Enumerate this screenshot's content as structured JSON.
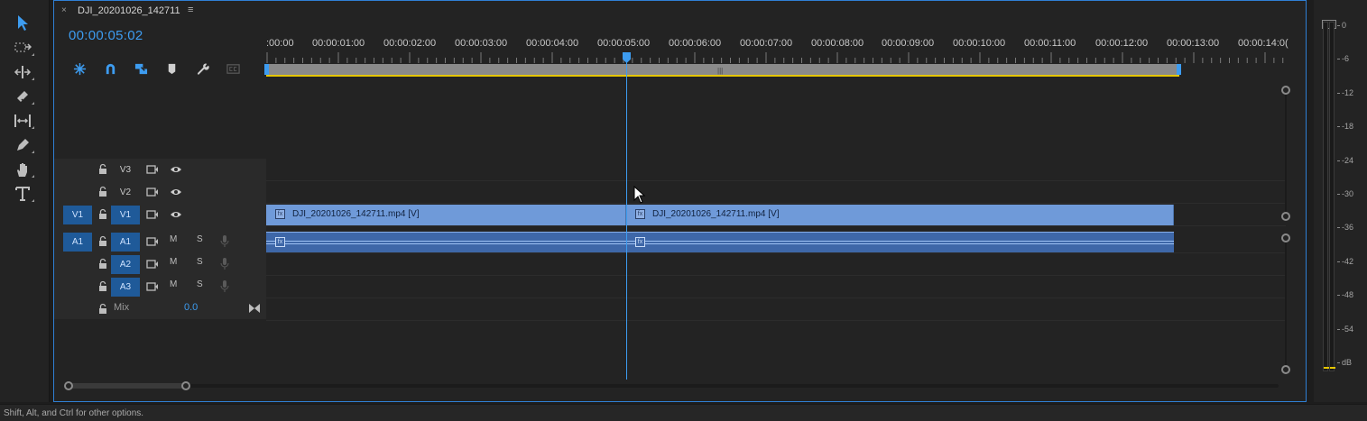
{
  "sequence": {
    "tab_title": "DJI_20201026_142711",
    "close_glyph": "×",
    "menu_glyph": "≡",
    "timecode": "00:00:05:02"
  },
  "toolbar_icons": [
    "ripple-edit-insert-icon",
    "snap-magnet-icon",
    "linked-selection-icon",
    "add-marker-icon",
    "timeline-settings-wrench-icon",
    "captions-icon"
  ],
  "tools": [
    "selection-tool-icon",
    "track-select-tool-icon",
    "ripple-edit-tool-icon",
    "razor-tool-icon",
    "slip-tool-icon",
    "pen-tool-icon",
    "hand-tool-icon",
    "type-tool-icon"
  ],
  "ruler": {
    "labels": [
      ":00:00",
      "00:00:01:00",
      "00:00:02:00",
      "00:00:03:00",
      "00:00:04:00",
      "00:00:05:00",
      "00:00:06:00",
      "00:00:07:00",
      "00:00:08:00",
      "00:00:09:00",
      "00:00:10:00",
      "00:00:11:00",
      "00:00:12:00",
      "00:00:13:00",
      "00:00:14:0("
    ]
  },
  "tracks": {
    "video": [
      {
        "name": "V3",
        "source_patch": "",
        "targeted": false
      },
      {
        "name": "V2",
        "source_patch": "",
        "targeted": false
      },
      {
        "name": "V1",
        "source_patch": "V1",
        "targeted": true
      }
    ],
    "audio": [
      {
        "name": "A1",
        "source_patch": "A1",
        "targeted": true,
        "mute": "M",
        "solo": "S"
      },
      {
        "name": "A2",
        "source_patch": "",
        "targeted": true,
        "mute": "M",
        "solo": "S"
      },
      {
        "name": "A3",
        "source_patch": "",
        "targeted": true,
        "mute": "M",
        "solo": "S"
      }
    ],
    "mix": {
      "label": "Mix",
      "value": "0.0"
    }
  },
  "clips": {
    "video": [
      {
        "label": "DJI_20201026_142711.mp4 [V]",
        "fx": "fx"
      },
      {
        "label": "DJI_20201026_142711.mp4 [V]",
        "fx": "fx"
      }
    ],
    "audio_fx": "fx"
  },
  "meter": {
    "labels": [
      "0",
      "-6",
      "-12",
      "-18",
      "-24",
      "-30",
      "-36",
      "-42",
      "-48",
      "-54",
      "dB"
    ],
    "peak_color": "#e5c600"
  },
  "status_bar": "Shift, Alt, and Ctrl for other options.",
  "colors": {
    "accent": "#3d9cf0",
    "video_clip": "#6f9ad9",
    "audio_clip": "#3e67a8",
    "work_area_bar": "#e5c600"
  }
}
